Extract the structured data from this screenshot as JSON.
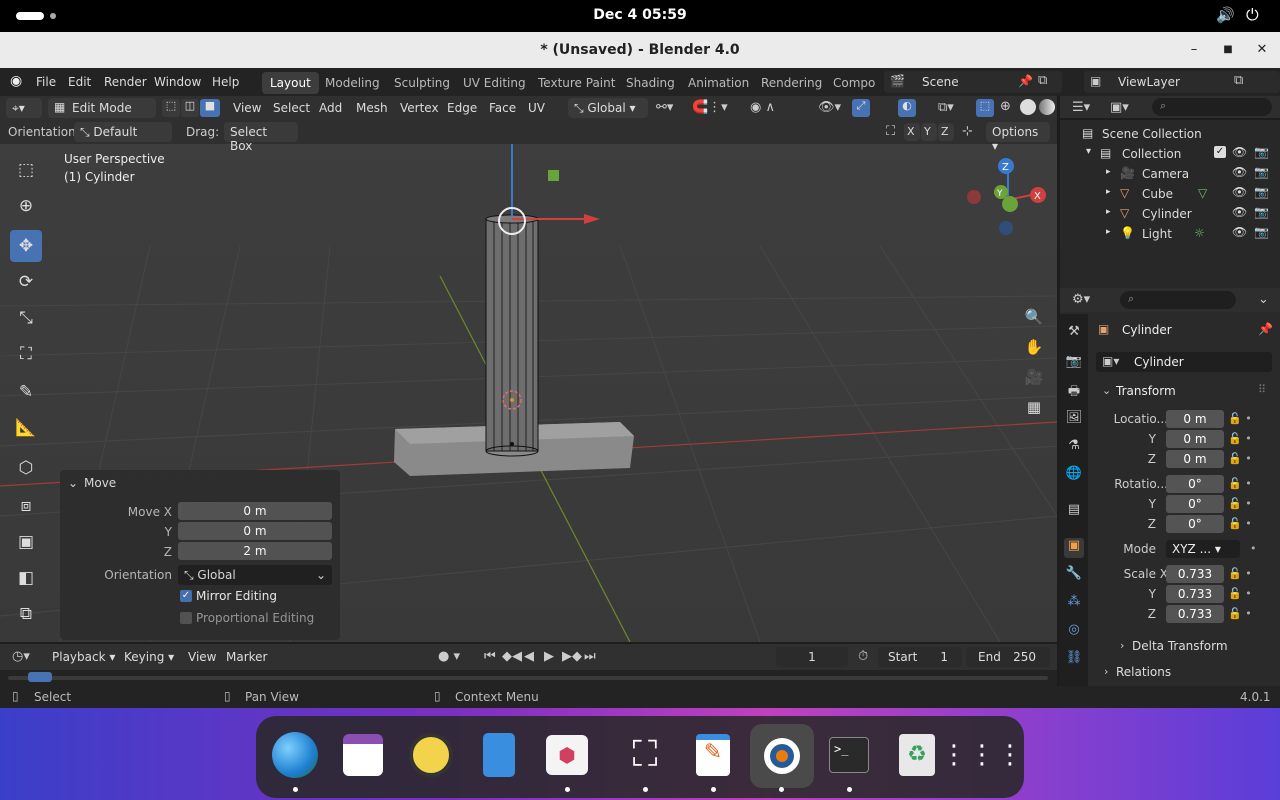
{
  "topbar": {
    "clock": "Dec 4  05:59"
  },
  "window": {
    "title": "* (Unsaved) - Blender 4.0"
  },
  "menu": {
    "items": [
      "File",
      "Edit",
      "Render",
      "Window",
      "Help"
    ]
  },
  "workspaces": [
    "Layout",
    "Modeling",
    "Sculpting",
    "UV Editing",
    "Texture Paint",
    "Shading",
    "Animation",
    "Rendering",
    "Compo"
  ],
  "scene": {
    "name": "Scene",
    "view_layer": "ViewLayer"
  },
  "viewport_header": {
    "mode": "Edit Mode",
    "menus": [
      "View",
      "Select",
      "Add",
      "Mesh",
      "Vertex",
      "Edge",
      "Face",
      "UV"
    ],
    "transform_orientation": "Global",
    "orientation_label": "Orientation:",
    "orientation_value": "Default",
    "drag_label": "Drag:",
    "drag_value": "Select Box",
    "axes": [
      "X",
      "Y",
      "Z"
    ],
    "options": "Options"
  },
  "viewport": {
    "perspective": "User Perspective",
    "object": "(1) Cylinder"
  },
  "move_panel": {
    "title": "Move",
    "fields": [
      {
        "label": "Move X",
        "value": "0 m"
      },
      {
        "label": "Y",
        "value": "0 m"
      },
      {
        "label": "Z",
        "value": "2 m"
      }
    ],
    "orientation_label": "Orientation",
    "orientation_value": "Global",
    "mirror_editing": "Mirror Editing",
    "proportional_editing": "Proportional Editing",
    "mirror_checked": true
  },
  "outliner": {
    "root": "Scene Collection",
    "collection": "Collection",
    "objects": [
      "Camera",
      "Cube",
      "Cylinder",
      "Light"
    ]
  },
  "properties": {
    "object_name": "Cylinder",
    "data_name": "Cylinder",
    "transform_title": "Transform",
    "location_label": "Locatio...",
    "location": [
      "0 m",
      "0 m",
      "0 m"
    ],
    "rotation_label": "Rotatio...",
    "rotation": [
      "0°",
      "0°",
      "0°"
    ],
    "mode_label": "Mode",
    "mode_value": "XYZ ...",
    "scale_label": "Scale X",
    "scale": [
      "0.733",
      "0.733",
      "0.733"
    ],
    "axis_y": "Y",
    "axis_z": "Z",
    "delta_transform": "Delta Transform",
    "relations": "Relations"
  },
  "timeline": {
    "menus": [
      "Playback",
      "Keying",
      "View",
      "Marker"
    ],
    "current_frame": "1",
    "start_label": "Start",
    "start": "1",
    "end_label": "End",
    "end": "250"
  },
  "status": {
    "select": "Select",
    "pan": "Pan View",
    "context": "Context Menu",
    "version": "4.0.1"
  }
}
